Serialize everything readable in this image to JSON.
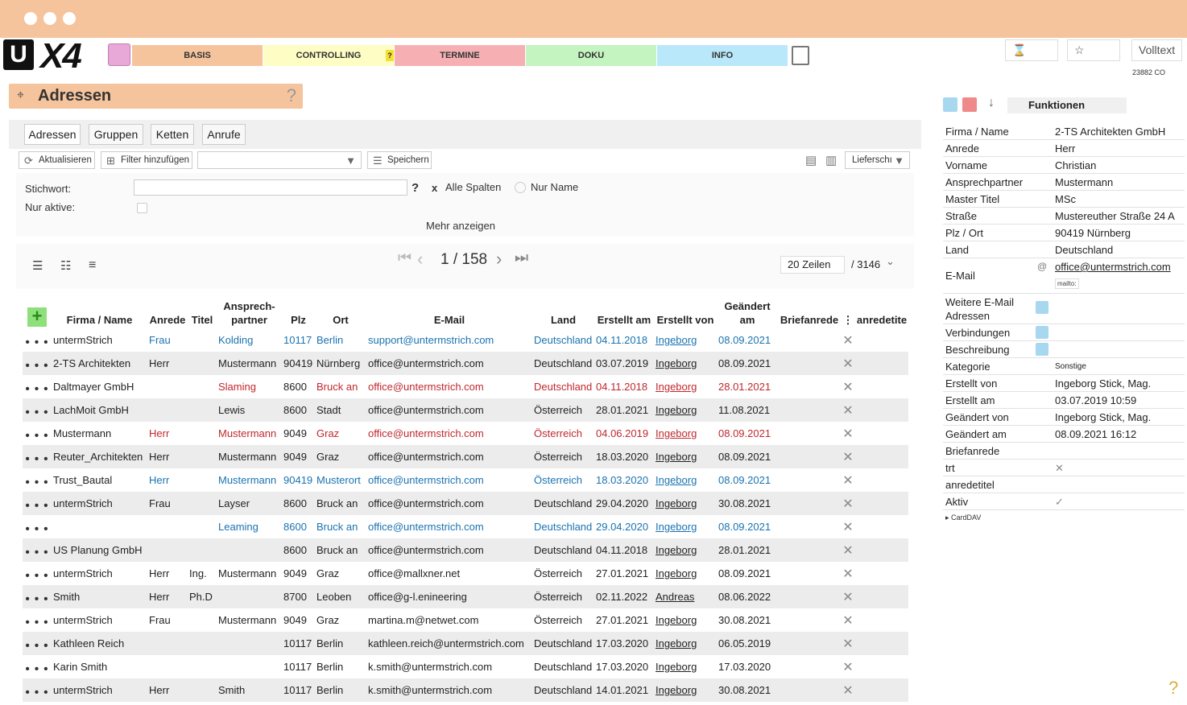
{
  "window": {
    "controls": [
      "close",
      "minimize",
      "maximize"
    ]
  },
  "nav": {
    "logo_u": "U",
    "logo_x4": "X4",
    "tabs": [
      {
        "label": "BASIS",
        "color": "#f6c49c"
      },
      {
        "label": "CONTROLLING",
        "color": "#fdfdc4",
        "badge": "?"
      },
      {
        "label": "TERMINE",
        "color": "#f6b0b4"
      },
      {
        "label": "DOKU",
        "color": "#c4f4c0"
      },
      {
        "label": "INFO",
        "color": "#b8e8fa"
      }
    ],
    "volltext_label": "Volltext",
    "build": "23882 CO"
  },
  "page": {
    "title": "Adressen",
    "help": "?"
  },
  "subtabs": [
    "Adressen",
    "Gruppen",
    "Ketten",
    "Anrufe"
  ],
  "toolbar": {
    "refresh": "Aktualisieren",
    "add_filter": "Filter hinzufügen",
    "save": "Speichern",
    "lieferschein": "Lieferschı"
  },
  "filter": {
    "keyword_label": "Stichwort:",
    "keyword_value": "",
    "help": "?",
    "all_columns": "Alle Spalten",
    "only_name": "Nur Name",
    "active_label": "Nur aktive:",
    "more": "Mehr anzeigen"
  },
  "pager": {
    "current": "1 / 158",
    "rows_select": "20 Zeilen",
    "total": "/ 3146"
  },
  "grid": {
    "columns": [
      "Firma / Name",
      "Anrede",
      "Titel",
      "Ansprech-partner",
      "Plz",
      "Ort",
      "E-Mail",
      "Land",
      "Erstellt am",
      "Erstellt von",
      "Geändert am",
      "Briefanrede",
      "⋮",
      "anredetite"
    ],
    "rows": [
      {
        "c": "mixed",
        "cells": [
          "untermStrich",
          "Frau",
          "",
          "Kolding",
          "10117",
          "Berlin",
          "support@untermstrich.com",
          "Deutschland",
          "04.11.2018",
          "Ingeborg",
          "08.09.2021"
        ]
      },
      {
        "c": "",
        "cells": [
          "2-TS Architekten",
          "Herr",
          "",
          "Mustermann",
          "90419",
          "Nürnberg",
          "office@untermstrich.com",
          "Deutschland",
          "03.07.2019",
          "Ingeborg",
          "08.09.2021"
        ]
      },
      {
        "c": "red",
        "cells": [
          "Daltmayer GmbH",
          "",
          "",
          "Slaming",
          "8600",
          "Bruck an",
          "office@untermstrich.com",
          "Deutschland",
          "04.11.2018",
          "Ingeborg",
          "28.01.2021"
        ]
      },
      {
        "c": "",
        "cells": [
          "LachMoit GmbH",
          "",
          "",
          "Lewis",
          "8600",
          "Stadt",
          "office@untermstrich.com",
          "Österreich",
          "28.01.2021",
          "Ingeborg",
          "11.08.2021"
        ]
      },
      {
        "c": "red",
        "cells": [
          "Mustermann",
          "Herr",
          "",
          "Mustermann",
          "9049",
          "Graz",
          "office@untermstrich.com",
          "Österreich",
          "04.06.2019",
          "Ingeborg",
          "08.09.2021"
        ]
      },
      {
        "c": "",
        "cells": [
          "Reuter_Architekten",
          "Herr",
          "",
          "Mustermann",
          "9049",
          "Graz",
          "office@untermstrich.com",
          "Österreich",
          "18.03.2020",
          "Ingeborg",
          "08.09.2021"
        ]
      },
      {
        "c": "blue",
        "cells": [
          "Trust_Bautal",
          "Herr",
          "",
          "Mustermann",
          "90419",
          "Musterort",
          "office@untermstrich.com",
          "Österreich",
          "18.03.2020",
          "Ingeborg",
          "08.09.2021"
        ]
      },
      {
        "c": "",
        "cells": [
          "untermStrich",
          "Frau",
          "",
          "Layser",
          "8600",
          "Bruck an",
          "office@untermstrich.com",
          "Deutschland",
          "29.04.2020",
          "Ingeborg",
          "30.08.2021"
        ]
      },
      {
        "c": "blue",
        "cells": [
          "",
          "",
          "",
          "Leaming",
          "8600",
          "Bruck an",
          "office@untermstrich.com",
          "Deutschland",
          "29.04.2020",
          "Ingeborg",
          "08.09.2021"
        ]
      },
      {
        "c": "",
        "cells": [
          "US Planung GmbH",
          "",
          "",
          "",
          "8600",
          "Bruck an",
          "office@untermstrich.com",
          "Deutschland",
          "04.11.2018",
          "Ingeborg",
          "28.01.2021"
        ]
      },
      {
        "c": "",
        "cells": [
          "untermStrich",
          "Herr",
          "Ing.",
          "Mustermann",
          "9049",
          "Graz",
          "office@mallxner.net",
          "Österreich",
          "27.01.2021",
          "Ingeborg",
          "08.09.2021"
        ]
      },
      {
        "c": "",
        "cells": [
          "Smith",
          "Herr",
          "Ph.D",
          "",
          "8700",
          "Leoben",
          "office@g-l.enineering",
          "Österreich",
          "02.11.2022",
          "Andreas",
          "08.06.2022"
        ]
      },
      {
        "c": "",
        "cells": [
          "untermStrich",
          "Frau",
          "",
          "Mustermann",
          "9049",
          "Graz",
          "martina.m@netwet.com",
          "Österreich",
          "27.01.2021",
          "Ingeborg",
          "30.08.2021"
        ]
      },
      {
        "c": "",
        "cells": [
          "Kathleen Reich",
          "",
          "",
          "",
          "10117",
          "Berlin",
          "kathleen.reich@untermstrich.com",
          "Deutschland",
          "17.03.2020",
          "Ingeborg",
          "06.05.2019"
        ]
      },
      {
        "c": "",
        "cells": [
          "Karin Smith",
          "",
          "",
          "",
          "10117",
          "Berlin",
          "k.smith@untermstrich.com",
          "Deutschland",
          "17.03.2020",
          "Ingeborg",
          "17.03.2020"
        ]
      },
      {
        "c": "",
        "cells": [
          "untermStrich",
          "Herr",
          "",
          "Smith",
          "10117",
          "Berlin",
          "k.smith@untermstrich.com",
          "Deutschland",
          "14.01.2021",
          "Ingeborg",
          "30.08.2021"
        ]
      }
    ],
    "dots": "• • •",
    "x": "✕"
  },
  "right": {
    "title": "Funktionen",
    "props": [
      {
        "k": "Firma / Name",
        "v": "2-TS Architekten GmbH"
      },
      {
        "k": "Anrede",
        "v": "Herr"
      },
      {
        "k": "Vorname",
        "v": "Christian"
      },
      {
        "k": "Ansprechpartner",
        "v": "Mustermann"
      },
      {
        "k": "Master Titel",
        "v": "MSc"
      },
      {
        "k": "Straße",
        "v": "Mustereuther Straße 24 A"
      },
      {
        "k": "Plz / Ort",
        "v": "90419 Nürnberg"
      },
      {
        "k": "Land",
        "v": "Deutschland"
      }
    ],
    "email_label": "E-Mail",
    "email": "office@untermstrich.com",
    "mailto": "mailto:",
    "props2": [
      {
        "k": "Weitere E-Mail Adressen",
        "v": ""
      },
      {
        "k": "Verbindungen",
        "v": ""
      },
      {
        "k": "Beschreibung",
        "v": ""
      },
      {
        "k": "Kategorie",
        "v": "Sonstige"
      },
      {
        "k": "Erstellt von",
        "v": "Ingeborg Stick, Mag."
      },
      {
        "k": "Erstellt am",
        "v": "03.07.2019 10:59"
      },
      {
        "k": "Geändert von",
        "v": "Ingeborg Stick, Mag."
      },
      {
        "k": "Geändert am",
        "v": "08.09.2021 16:12"
      },
      {
        "k": "Briefanrede",
        "v": ""
      },
      {
        "k": "trt",
        "v": "✕"
      },
      {
        "k": "anredetitel",
        "v": ""
      },
      {
        "k": "Aktiv",
        "v": "✓"
      }
    ],
    "carddav": "▸ CardDAV"
  }
}
